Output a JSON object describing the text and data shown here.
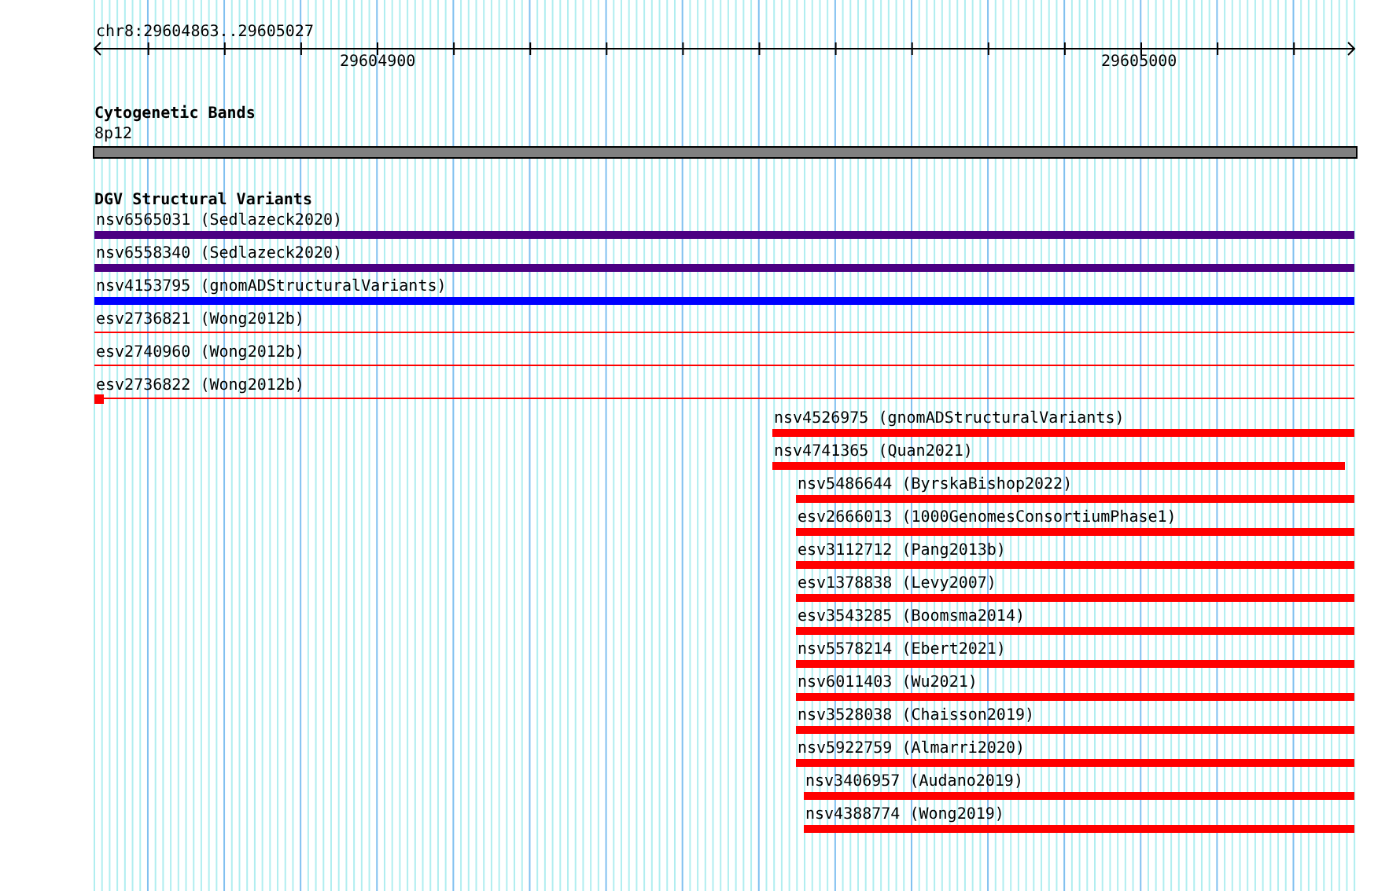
{
  "ruler": {
    "location": "chr8:29604863..29605027",
    "tick_labels": [
      "29604900",
      "29605000"
    ]
  },
  "tracks": [
    {
      "title": "Cytogenetic Bands",
      "features": [
        {
          "label": "8p12",
          "kind": "band",
          "color": "#808080"
        }
      ]
    },
    {
      "title": "DGV Structural Variants",
      "features": [
        {
          "label": "nsv6565031 (Sedlazeck2020)",
          "kind": "bar",
          "color": "#4b0082"
        },
        {
          "label": "nsv6558340 (Sedlazeck2020)",
          "kind": "bar",
          "color": "#4b0082"
        },
        {
          "label": "nsv4153795 (gnomADStructuralVariants)",
          "kind": "bar",
          "color": "#0000ff"
        },
        {
          "label": "esv2736821 (Wong2012b)",
          "kind": "line",
          "color": "#ff0000"
        },
        {
          "label": "esv2740960 (Wong2012b)",
          "kind": "line",
          "color": "#ff0000"
        },
        {
          "label": "esv2736822 (Wong2012b)",
          "kind": "line-block",
          "color": "#ff0000"
        },
        {
          "label": "nsv4526975 (gnomADStructuralVariants)",
          "kind": "bar",
          "color": "#ff0000"
        },
        {
          "label": "nsv4741365 (Quan2021)",
          "kind": "bar",
          "color": "#ff0000"
        },
        {
          "label": "nsv5486644 (ByrskaBishop2022)",
          "kind": "bar",
          "color": "#ff0000"
        },
        {
          "label": "esv2666013 (1000GenomesConsortiumPhase1)",
          "kind": "bar",
          "color": "#ff0000"
        },
        {
          "label": "esv3112712 (Pang2013b)",
          "kind": "bar",
          "color": "#ff0000"
        },
        {
          "label": "esv1378838 (Levy2007)",
          "kind": "bar",
          "color": "#ff0000"
        },
        {
          "label": "esv3543285 (Boomsma2014)",
          "kind": "bar",
          "color": "#ff0000"
        },
        {
          "label": "nsv5578214 (Ebert2021)",
          "kind": "bar",
          "color": "#ff0000"
        },
        {
          "label": "nsv6011403 (Wu2021)",
          "kind": "bar",
          "color": "#ff0000"
        },
        {
          "label": "nsv3528038 (Chaisson2019)",
          "kind": "bar",
          "color": "#ff0000"
        },
        {
          "label": "nsv5922759 (Almarri2020)",
          "kind": "bar",
          "color": "#ff0000"
        },
        {
          "label": "nsv3406957 (Audano2019)",
          "kind": "bar",
          "color": "#ff0000"
        },
        {
          "label": "nsv4388774 (Wong2019)",
          "kind": "bar",
          "color": "#ff0000"
        }
      ]
    }
  ]
}
